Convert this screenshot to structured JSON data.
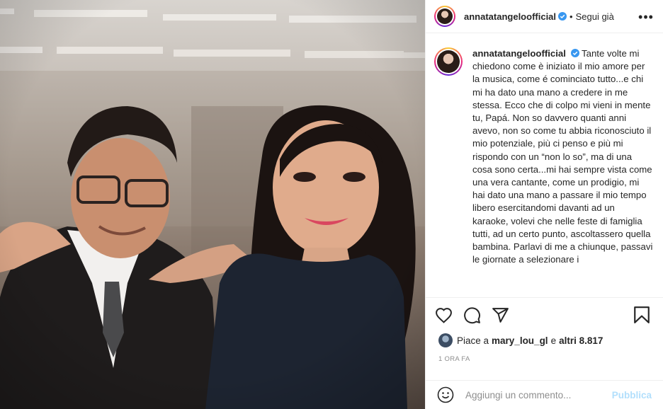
{
  "post": {
    "username": "annatatangeloofficial",
    "separator": "•",
    "follow_state": "Segui già",
    "more": "•••",
    "caption_body": "Tante volte mi chiedono come è iniziato il mio amore per la musica, come é cominciato tutto...e chi mi ha dato una mano a credere in me stessa. Ecco che di colpo mi vieni in mente tu, Papá. Non so davvero quanti anni avevo, non so come tu abbia riconosciuto il mio potenziale, più ci penso e più mi rispondo con un “non lo so”, ma di una cosa sono certa...mi hai sempre vista come una vera cantante, come un prodigio, mi hai dato una mano a passare il mio tempo libero esercitandomi davanti ad un karaoke, volevi che nelle feste di famiglia tutti, ad un certo punto, ascoltassero quella bambina. Parlavi di me a chiunque, passavi le giornate a selezionare i",
    "likes": {
      "prefix": "Piace a",
      "user": "mary_lou_gl",
      "middle": "e",
      "others": "altri 8.817"
    },
    "timestamp": "1 ORA FA",
    "comment": {
      "placeholder": "Aggiungi un commento...",
      "value": "",
      "submit_label": "Pubblica"
    }
  },
  "colors": {
    "verified": "#3897f0",
    "link_disabled": "#b2dffc",
    "muted": "#8e8e8e",
    "text": "#262626"
  },
  "icons": {
    "header": [
      "avatar",
      "verified-icon",
      "more-icon"
    ],
    "actions": [
      "heart-icon",
      "comment-icon",
      "share-icon",
      "bookmark-icon"
    ],
    "comment": [
      "emoji-icon"
    ]
  }
}
